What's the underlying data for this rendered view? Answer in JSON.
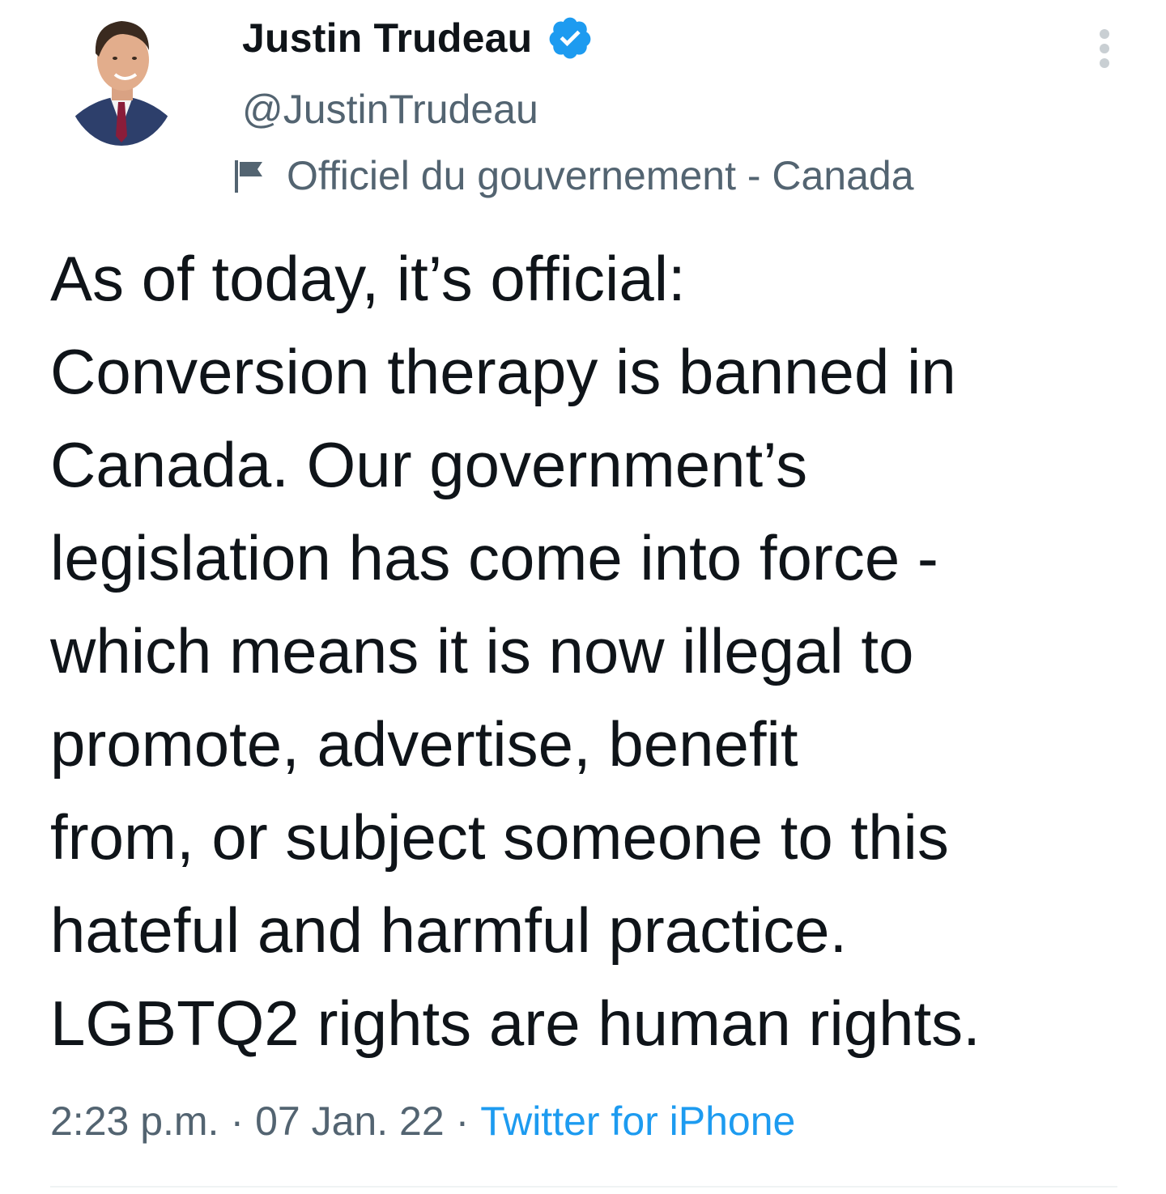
{
  "author": {
    "name": "Justin Trudeau",
    "handle": "@JustinTrudeau",
    "verified": true,
    "label": "Officiel du gouvernement - Canada"
  },
  "icons": {
    "avatar": "profile-photo",
    "verified": "verified-badge-icon",
    "label": "government-flag-icon",
    "menu": "more-vertical-icon"
  },
  "tweet": {
    "lines": [
      "As of today, it’s official:",
      "Conversion therapy is banned in",
      "Canada. Our government’s",
      "legislation has come into force -",
      "which means it is now illegal to",
      "promote, advertise, benefit",
      "from, or subject someone to this",
      "hateful and harmful practice.",
      "LGBTQ2 rights are human rights."
    ]
  },
  "meta": {
    "time": "2:23 p.m.",
    "separator": "·",
    "date": "07 Jan. 22",
    "source": "Twitter for iPhone"
  },
  "colors": {
    "text": "#0f1419",
    "secondary": "#536471",
    "link": "#1d9bf0",
    "verified": "#1d9bf0"
  }
}
